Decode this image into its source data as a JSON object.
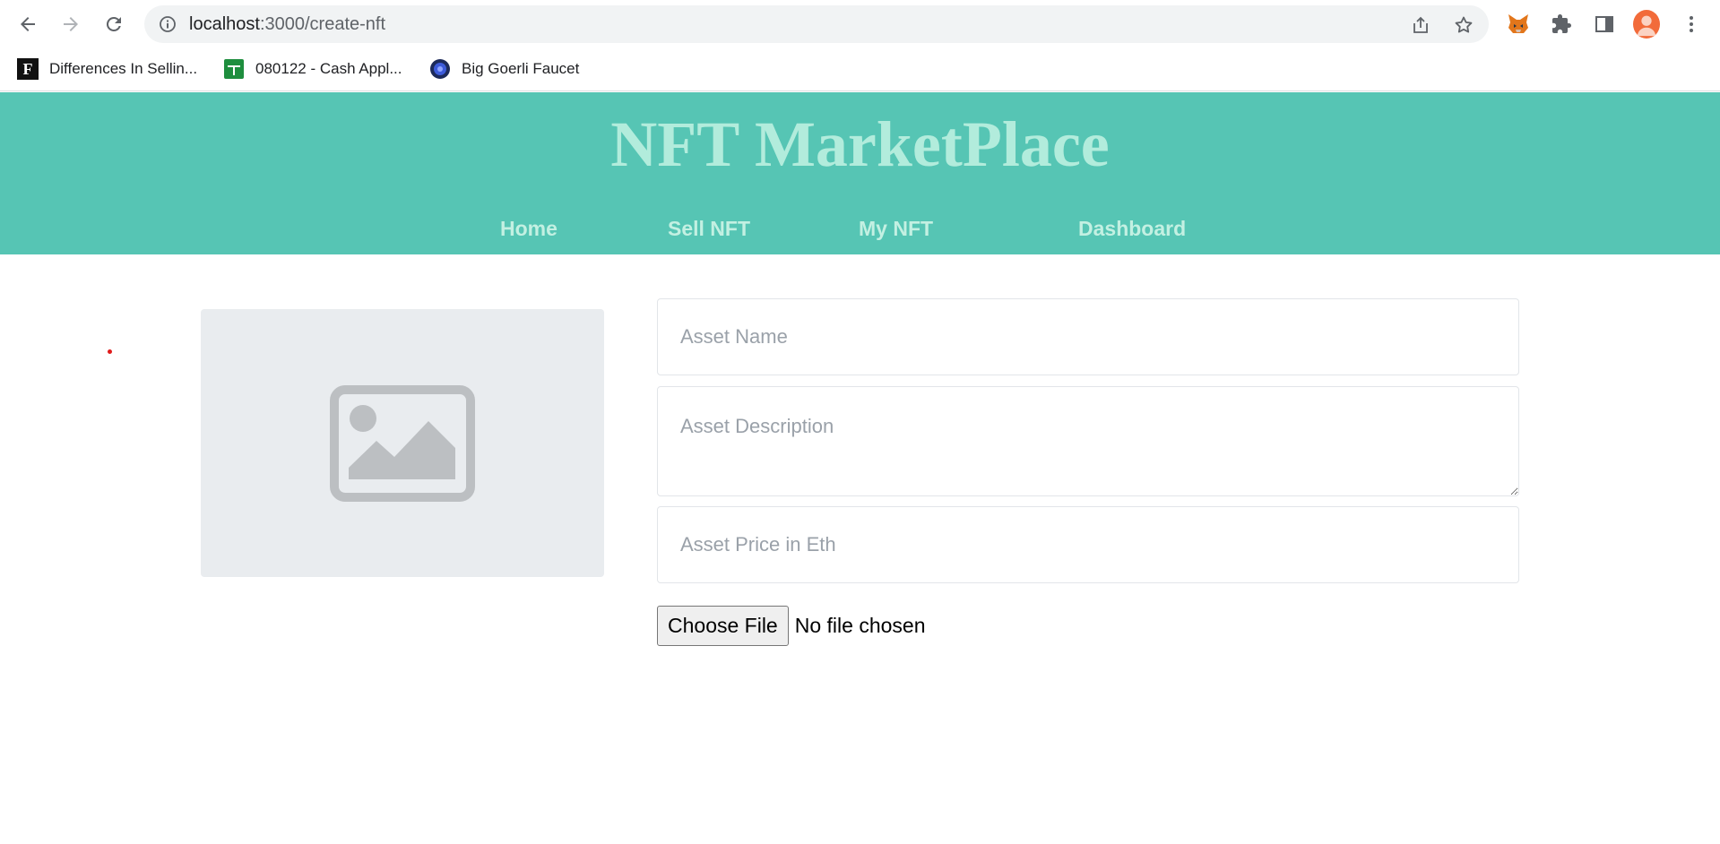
{
  "browser": {
    "url_host": "localhost",
    "url_path": ":3000/create-nft",
    "icons": {
      "back": "arrow-left-icon",
      "forward": "arrow-right-icon",
      "reload": "reload-icon",
      "info": "info-icon",
      "share": "share-icon",
      "bookmark": "star-icon",
      "metamask": "fox-icon",
      "extensions": "puzzle-icon",
      "side_panel": "side-panel-icon",
      "profile": "avatar-icon",
      "menu": "kebab-menu-icon"
    }
  },
  "bookmarks": [
    {
      "label": "Differences In Sellin...",
      "favicon_letter": "F"
    },
    {
      "label": "080122 - Cash Appl..."
    },
    {
      "label": "Big Goerli Faucet"
    }
  ],
  "site": {
    "title": "NFT MarketPlace",
    "nav": [
      "Home",
      "Sell NFT",
      "My NFT",
      "Dashboard"
    ]
  },
  "form": {
    "name_placeholder": "Asset Name",
    "description_placeholder": "Asset Description",
    "price_placeholder": "Asset Price in Eth",
    "file_button": "Choose File",
    "file_status": "No file chosen"
  },
  "colors": {
    "header_bg": "#56c5b4",
    "title": "#b2ecdc",
    "nav_text": "#c3f0e2",
    "preview_bg": "#e9ecef"
  }
}
